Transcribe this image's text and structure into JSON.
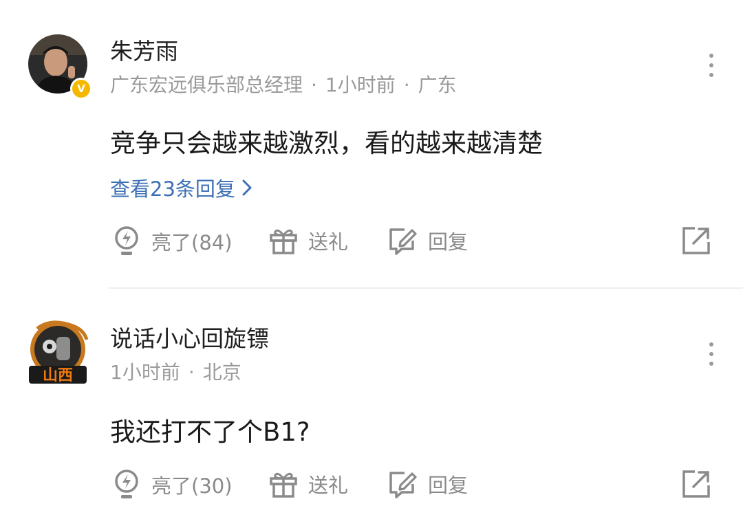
{
  "comments": [
    {
      "username": "朱芳雨",
      "title": "广东宏远俱乐部总经理",
      "time": "1小时前",
      "location": "广东",
      "text": "竞争只会越来越激烈，看的越来越清楚",
      "replies_label": "查看23条回复",
      "verified_badge": "V",
      "actions": {
        "like": "亮了(84)",
        "gift": "送礼",
        "reply": "回复"
      }
    },
    {
      "username": "说话小心回旋镖",
      "time": "1小时前",
      "location": "北京",
      "text": "我还打不了个B1?",
      "avatar_badge_text": "山西",
      "actions": {
        "like": "亮了(30)",
        "gift": "送礼",
        "reply": "回复"
      }
    }
  ],
  "separator": "·",
  "icons": {
    "like": "lightbulb-icon",
    "gift": "gift-icon",
    "reply": "edit-reply-icon",
    "share": "share-icon",
    "more": "more-vertical-icon",
    "chevron": "chevron-right-icon"
  },
  "colors": {
    "link": "#3d6fb4",
    "muted": "#9a9a9a",
    "badge": "#f5b800"
  }
}
